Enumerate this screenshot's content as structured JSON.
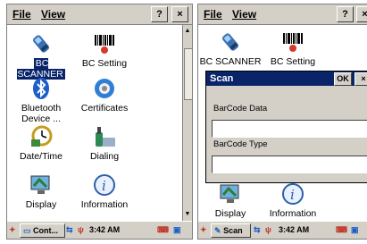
{
  "left": {
    "menu": {
      "file": "File",
      "view": "View"
    },
    "title_buttons": {
      "help": "?",
      "close": "×"
    },
    "items": [
      {
        "label": "BC SCANNER",
        "icon": "scanner-icon",
        "selected": true
      },
      {
        "label": "BC Setting",
        "icon": "barcode-icon"
      },
      {
        "label": "Bluetooth Device ...",
        "icon": "bluetooth-icon"
      },
      {
        "label": "Certificates",
        "icon": "certificate-icon"
      },
      {
        "label": "Date/Time",
        "icon": "clock-icon"
      },
      {
        "label": "Dialing",
        "icon": "phone-icon"
      },
      {
        "label": "Display",
        "icon": "display-icon"
      },
      {
        "label": "Information",
        "icon": "info-icon"
      }
    ],
    "taskbar": {
      "app": "Cont...",
      "time": "3:42 AM"
    }
  },
  "right": {
    "menu": {
      "file": "File",
      "view": "View"
    },
    "title_buttons": {
      "help": "?",
      "close": "×"
    },
    "items": [
      {
        "label": "BC SCANNER",
        "icon": "scanner-icon"
      },
      {
        "label": "BC Setting",
        "icon": "barcode-icon"
      },
      {
        "label": "Display",
        "icon": "display-icon"
      },
      {
        "label": "Information",
        "icon": "info-icon"
      }
    ],
    "dialog": {
      "title": "Scan",
      "ok": "OK",
      "close": "×",
      "barcode_data_label": "BarCode Data",
      "barcode_type_label": "BarCode Type",
      "barcode_data_value": "",
      "barcode_type_value": ""
    },
    "taskbar": {
      "app": "Scan",
      "time": "3:42 AM"
    }
  },
  "colors": {
    "selection": "#0a246a",
    "chrome": "#d4d0c8"
  }
}
